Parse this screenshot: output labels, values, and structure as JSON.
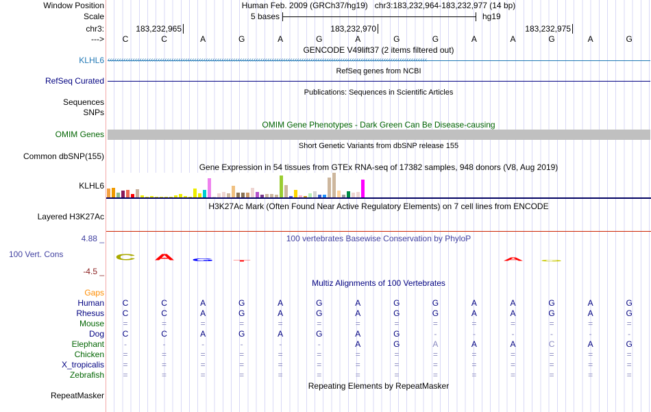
{
  "header": {
    "window_position_label": "Window Position",
    "window_position": "Human Feb. 2009 (GRCh37/hg19)   chr3:183,232,964-183,232,977 (14 bp)",
    "scale_label": "Scale",
    "scale_text": "5 bases",
    "scale_assembly": "hg19",
    "chrom_label": "chr3:",
    "strand_label": "--->",
    "coord_ticks": [
      "183,232,965",
      "183,232,970",
      "183,232,975"
    ]
  },
  "sequence": [
    "C",
    "C",
    "A",
    "G",
    "A",
    "G",
    "A",
    "G",
    "G",
    "A",
    "A",
    "G",
    "A",
    "G"
  ],
  "tracks": {
    "gencode": {
      "title": "GENCODE V49lift37 (2 items filtered out)",
      "label": "KLHL6",
      "color": "#1f77b4"
    },
    "refseq": {
      "title": "RefSeq genes from NCBI",
      "label": "RefSeq Curated",
      "color": "#000080"
    },
    "publications": {
      "title": "Publications: Sequences in Scientific Articles",
      "label1": "Sequences",
      "label2": "SNPs"
    },
    "omim": {
      "title": "OMIM Gene Phenotypes - Dark Green Can Be Disease-causing",
      "label": "OMIM Genes",
      "color": "#006400"
    },
    "dbsnp": {
      "title": "Short Genetic Variants from dbSNP release 155",
      "label": "Common dbSNP(155)"
    },
    "gtex": {
      "title": "Gene Expression in 54 tissues from GTEx RNA-seq of 17382 samples, 948 donors (V8, Aug 2019)",
      "label": "KLHL6"
    },
    "h3k27ac": {
      "title": "H3K27Ac Mark (Often Found Near Active Regulatory Elements) on 7 cell lines from ENCODE",
      "label": "Layered H3K27Ac"
    },
    "phylop": {
      "title": "100 vertebrates Basewise Conservation by PhyloP",
      "label": "100 Vert. Cons",
      "max": "4.88 _",
      "min": "-4.5 _"
    },
    "multiz": {
      "title": "Multiz Alignments of 100 Vertebrates",
      "gaps_label": "Gaps"
    },
    "repeatmasker": {
      "title": "Repeating Elements by RepeatMasker",
      "label": "RepeatMasker"
    }
  },
  "gtex_bars": {
    "values": [
      13,
      14,
      7,
      10,
      11,
      5,
      12,
      3,
      1,
      2,
      1,
      1,
      1,
      1,
      3,
      5,
      2,
      1,
      13,
      6,
      11,
      28,
      0.3,
      6,
      8,
      6,
      17,
      7,
      7,
      7,
      14,
      8,
      4,
      5,
      5,
      4,
      32,
      18,
      2,
      11,
      3,
      2,
      6,
      9,
      4,
      4,
      29,
      36,
      10,
      4,
      9,
      7,
      8,
      26
    ],
    "colors": [
      "#f4a040",
      "#f09a00",
      "#8fbc8f",
      "#8b1a5a",
      "#ee6a50",
      "#ff0000",
      "#c8b09a",
      "#eeee00",
      "#eeee00",
      "#eeee00",
      "#eeee00",
      "#eeee00",
      "#eeee00",
      "#eeee00",
      "#eeee00",
      "#eeee00",
      "#eeee00",
      "#eeee00",
      "#eeee00",
      "#eeee00",
      "#00ced1",
      "#ee82ee",
      "#e8d0d0",
      "#eed5d2",
      "#eed5d2",
      "#cdb79e",
      "#f0c080",
      "#8b7355",
      "#8b7355",
      "#cd9b6a",
      "#eed5d2",
      "#b452cd",
      "#7a378b",
      "#cdb79e",
      "#cdb79e",
      "#cdb79e",
      "#9acd32",
      "#cdb79e",
      "#4f56d8",
      "#ffd700",
      "#ffb6c1",
      "#cd9b1d",
      "#b4eeb4",
      "#d3d3d3",
      "#3a5fcd",
      "#1e90ff",
      "#cdb79e",
      "#cdb79e",
      "#ffd39b",
      "#a0a0a0",
      "#008b45",
      "#eed5d2",
      "#eed5d2",
      "#ff00ff"
    ]
  },
  "phylop_logo": [
    {
      "base": 0,
      "letter": "C",
      "color": "#aaaa00",
      "h": 1.0
    },
    {
      "base": 1,
      "letter": "A",
      "color": "#ff0000",
      "h": 1.0
    },
    {
      "base": 2,
      "letter": "G",
      "color": "#0000ff",
      "h": 0.4
    },
    {
      "base": 3,
      "letter": "T",
      "color": "#ff0000",
      "h": 0.2
    },
    {
      "base": 10,
      "letter": "A",
      "color": "#ff0000",
      "h": 0.6
    },
    {
      "base": 11,
      "letter": "G",
      "color": "#c8c800",
      "h": 0.3
    }
  ],
  "alignment": [
    {
      "species": "Human",
      "color": "#000080",
      "bases": [
        "C",
        "C",
        "A",
        "G",
        "A",
        "G",
        "A",
        "G",
        "G",
        "A",
        "A",
        "G",
        "A",
        "G"
      ]
    },
    {
      "species": "Rhesus",
      "color": "#000080",
      "bases": [
        "C",
        "C",
        "A",
        "G",
        "A",
        "G",
        "A",
        "G",
        "G",
        "A",
        "A",
        "G",
        "A",
        "G"
      ]
    },
    {
      "species": "Mouse",
      "color": "#006400",
      "bases": [
        "=",
        "=",
        "=",
        "=",
        "=",
        "=",
        "=",
        "=",
        "=",
        "=",
        "=",
        "=",
        "=",
        "="
      ]
    },
    {
      "species": "Dog",
      "color": "#000080",
      "bases": [
        "C",
        "C",
        "A",
        "G",
        "A",
        "G",
        "A",
        "G",
        "-",
        "-",
        "-",
        "-",
        "-",
        "-"
      ]
    },
    {
      "species": "Elephant",
      "color": "#006400",
      "bases": [
        "-",
        "-",
        "-",
        "-",
        "-",
        "-",
        "A",
        "G",
        "A",
        "A",
        "A",
        "C",
        "A",
        "G"
      ],
      "faded": [
        8,
        11
      ]
    },
    {
      "species": "Chicken",
      "color": "#006400",
      "bases": [
        "=",
        "=",
        "=",
        "=",
        "=",
        "=",
        "=",
        "=",
        "=",
        "=",
        "=",
        "=",
        "=",
        "="
      ]
    },
    {
      "species": "X_tropicalis",
      "color": "#000080",
      "bases": [
        "=",
        "=",
        "=",
        "=",
        "=",
        "=",
        "=",
        "=",
        "=",
        "=",
        "=",
        "=",
        "=",
        "="
      ]
    },
    {
      "species": "Zebrafish",
      "color": "#006400",
      "bases": [
        "=",
        "=",
        "=",
        "=",
        "=",
        "=",
        "=",
        "=",
        "=",
        "=",
        "=",
        "=",
        "=",
        "="
      ]
    }
  ]
}
